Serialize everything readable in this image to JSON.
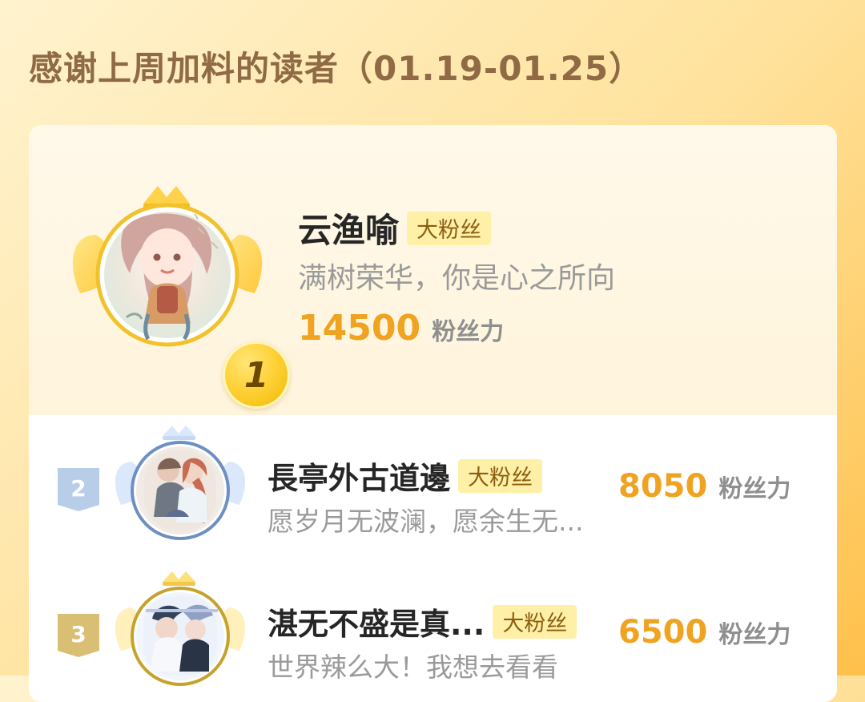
{
  "page": {
    "title": "感谢上周加料的读者（01.19-01.25）"
  },
  "leaderboard": {
    "top": {
      "rank": "1",
      "name": "云渔喻",
      "badge": "大粉丝",
      "message": "满树荣华，你是心之所向",
      "score": "14500",
      "score_unit": "粉丝力"
    },
    "others": [
      {
        "rank": "2",
        "name": "長亭外古道邊",
        "badge": "大粉丝",
        "message": "愿岁月无波澜，愿余生无...",
        "score": "8050",
        "score_unit": "粉丝力"
      },
      {
        "rank": "3",
        "name": "湛无不盛是真...",
        "badge": "大粉丝",
        "message": "世界辣么大！我想去看看",
        "score": "6500",
        "score_unit": "粉丝力"
      }
    ]
  },
  "icons": {
    "crown_gold": "crown-icon",
    "wings_gold": "wing-icon",
    "crown_blue": "crown-icon",
    "wings_blue": "wing-icon",
    "rank_badge": "ribbon-icon"
  },
  "colors": {
    "page_bg_top": "#fff3cf",
    "page_bg_bottom": "#ffc04a",
    "title": "#8f6a45",
    "score": "#f0a221",
    "badge_bg": "#fff0a8",
    "silver_rank": "#b8cde8",
    "bronze_rank": "#d9bf73"
  }
}
